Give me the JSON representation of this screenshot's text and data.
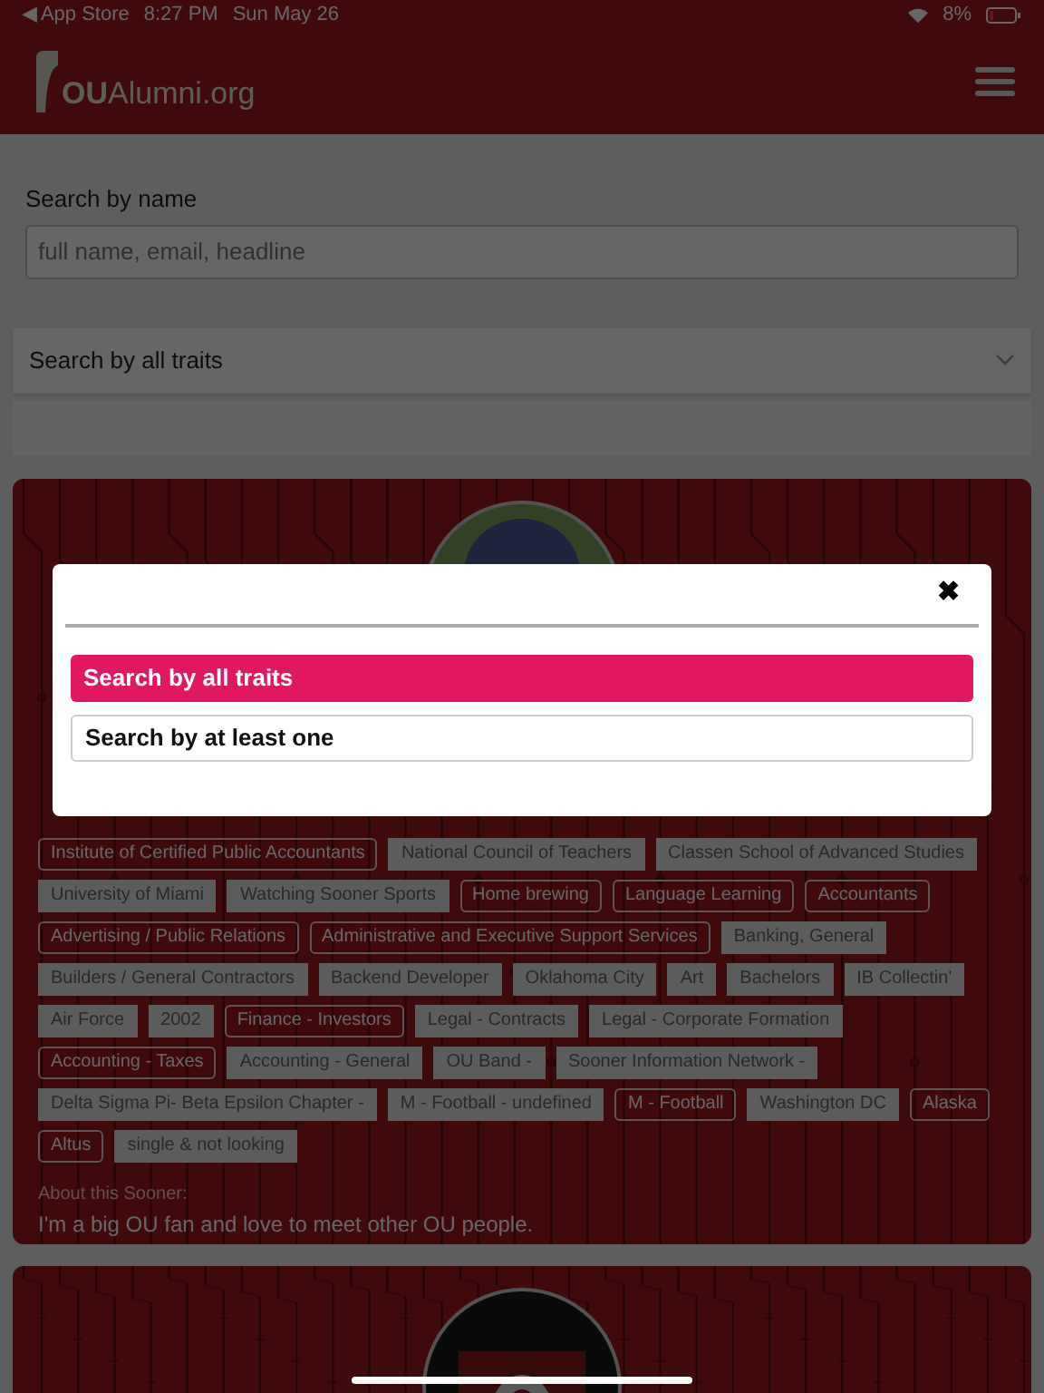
{
  "status_bar": {
    "back": "◀ App Store",
    "time": "8:27 PM",
    "date": "Sun May 26",
    "battery": "8%"
  },
  "header": {
    "logo": "**OU**Alumni.org"
  },
  "search": {
    "label": "Search by name",
    "placeholder": "full name, email, headline",
    "mode": "Search by all traits"
  },
  "profile": {
    "tags": [
      {
        "label": "Institute of Certified Public Accountants",
        "kind": "outlined"
      },
      {
        "label": "National Council of Teachers",
        "kind": "filled"
      },
      {
        "label": "Classen School of Advanced Studies",
        "kind": "filled"
      },
      {
        "label": "University of Miami",
        "kind": "filled"
      },
      {
        "label": "Watching Sooner Sports",
        "kind": "filled"
      },
      {
        "label": "Home brewing",
        "kind": "outlined"
      },
      {
        "label": "Language Learning",
        "kind": "outlined"
      },
      {
        "label": "Accountants",
        "kind": "outlined"
      },
      {
        "label": "Advertising / Public Relations",
        "kind": "outlined"
      },
      {
        "label": "Administrative and Executive Support Services",
        "kind": "outlined"
      },
      {
        "label": "Banking, General",
        "kind": "filled"
      },
      {
        "label": "Builders / General Contractors",
        "kind": "filled"
      },
      {
        "label": "Backend Developer",
        "kind": "filled"
      },
      {
        "label": "Oklahoma City",
        "kind": "filled"
      },
      {
        "label": "Art",
        "kind": "filled"
      },
      {
        "label": "Bachelors",
        "kind": "filled"
      },
      {
        "label": "IB Collectin'",
        "kind": "filled"
      },
      {
        "label": "Air Force",
        "kind": "filled"
      },
      {
        "label": "2002",
        "kind": "filled"
      },
      {
        "label": "Finance - Investors",
        "kind": "outlined"
      },
      {
        "label": "Legal - Contracts",
        "kind": "filled"
      },
      {
        "label": "Legal - Corporate Formation",
        "kind": "filled"
      },
      {
        "label": "Accounting - Taxes",
        "kind": "outlined"
      },
      {
        "label": "Accounting - General",
        "kind": "filled"
      },
      {
        "label": "OU Band -",
        "kind": "filled"
      },
      {
        "label": "Sooner Information Network -",
        "kind": "filled"
      },
      {
        "label": "Delta Sigma Pi- Beta Epsilon Chapter -",
        "kind": "filled"
      },
      {
        "label": "M - Football - undefined",
        "kind": "filled"
      },
      {
        "label": "M - Football",
        "kind": "outlined"
      },
      {
        "label": "Washington DC",
        "kind": "filled"
      },
      {
        "label": "Alaska",
        "kind": "outlined"
      },
      {
        "label": "Altus",
        "kind": "outlined"
      },
      {
        "label": "single & not looking",
        "kind": "filled"
      }
    ],
    "about_label": "About this Sooner:",
    "about": "I'm a big OU fan and love to meet other OU people."
  },
  "modal": {
    "close": "✖",
    "options": [
      {
        "label": "Search by all traits",
        "selected": true
      },
      {
        "label": "Search by at least one",
        "selected": false
      }
    ]
  }
}
